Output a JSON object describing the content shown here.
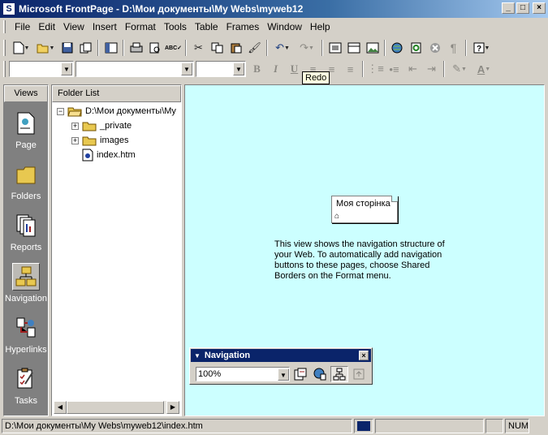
{
  "window": {
    "title": "Microsoft FrontPage - D:\\Мои документы\\My Webs\\myweb12",
    "minimize": "_",
    "maximize": "□",
    "close": "×"
  },
  "menu": [
    "File",
    "Edit",
    "View",
    "Insert",
    "Format",
    "Tools",
    "Table",
    "Frames",
    "Window",
    "Help"
  ],
  "tooltip": "Redo",
  "views": {
    "header": "Views",
    "items": [
      {
        "label": "Page",
        "icon": "page-view-icon"
      },
      {
        "label": "Folders",
        "icon": "folders-view-icon"
      },
      {
        "label": "Reports",
        "icon": "reports-view-icon"
      },
      {
        "label": "Navigation",
        "icon": "navigation-view-icon",
        "active": true
      },
      {
        "label": "Hyperlinks",
        "icon": "hyperlinks-view-icon"
      },
      {
        "label": "Tasks",
        "icon": "tasks-view-icon"
      }
    ]
  },
  "folder_list": {
    "header": "Folder List",
    "root": "D:\\Мои документы\\My",
    "items": [
      "_private",
      "images",
      "index.htm"
    ]
  },
  "navigation_view": {
    "page_title": "Моя сторінка",
    "help_text": "This view shows the navigation structure of your Web. To automatically add navigation buttons to these pages, choose Shared Borders on the Format menu."
  },
  "nav_toolbar": {
    "title": "Navigation",
    "zoom": "100%"
  },
  "status": {
    "path": "D:\\Мои документы\\My Webs\\myweb12\\index.htm",
    "num": "NUM"
  }
}
